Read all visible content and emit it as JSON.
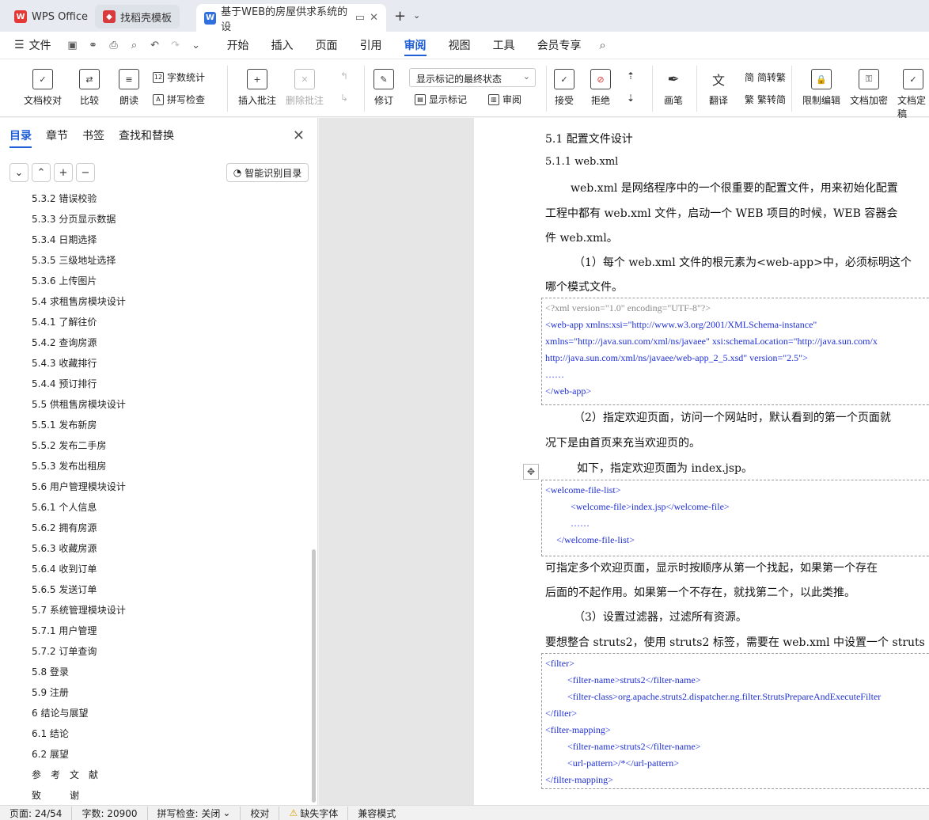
{
  "tabs": [
    {
      "label": "WPS Office"
    },
    {
      "label": "找稻壳模板"
    },
    {
      "label": "基于WEB的房屋供求系统的设"
    }
  ],
  "menu": {
    "file": "文件",
    "items": [
      "开始",
      "插入",
      "页面",
      "引用",
      "审阅",
      "视图",
      "工具",
      "会员专享"
    ]
  },
  "ribbon": {
    "doc_check": "文档校对",
    "compare": "比较",
    "read": "朗读",
    "word_count": "字数统计",
    "spell_check": "拼写检查",
    "insert_comment": "插入批注",
    "delete_comment": "删除批注",
    "revise": "修订",
    "markup_select": "显示标记的最终状态",
    "show_markup": "显示标记",
    "review": "审阅",
    "accept": "接受",
    "reject": "拒绝",
    "pen": "画笔",
    "translate": "翻译",
    "to_trad": "简转繁",
    "to_simp": "繁转简",
    "restrict": "限制编辑",
    "encrypt": "文档加密",
    "doc_final": "文档定稿"
  },
  "sidebar": {
    "tabs": [
      "目录",
      "章节",
      "书签",
      "查找和替换"
    ],
    "smart_toc": "智能识别目录",
    "toc": [
      "5.3.2 错误校验",
      "5.3.3 分页显示数据",
      "5.3.4 日期选择",
      "5.3.5 三级地址选择",
      "5.3.6 上传图片",
      "5.4 求租售房模块设计",
      "5.4.1 了解往价",
      "5.4.2 查询房源",
      "5.4.3 收藏排行",
      "5.4.4 预订排行",
      "5.5 供租售房模块设计",
      "5.5.1 发布新房",
      "5.5.2 发布二手房",
      "5.5.3 发布出租房",
      "5.6 用户管理模块设计",
      "5.6.1 个人信息",
      "5.6.2 拥有房源",
      "5.6.3 收藏房源",
      "5.6.4 收到订单",
      "5.6.5 发送订单",
      "5.7 系统管理模块设计",
      "5.7.1 用户管理",
      "5.7.2 订单查询",
      "5.8 登录",
      "5.9 注册",
      "6 结论与展望",
      "6.1 结论",
      "6.2 展望",
      "参　考　文　献",
      "致　　　谢"
    ]
  },
  "doc": {
    "h1": "5.1  配置文件设计",
    "h2": "5.1.1 web.xml",
    "p1a": "web.xml 是网络程序中的一个很重要的配置文件，用来初始化配置",
    "p1b": "工程中都有 web.xml 文件，启动一个 WEB 项目的时候，WEB 容器会",
    "p1c": "件 web.xml。",
    "p2a": "（1）每个 web.xml 文件的根元素为<web-app>中，必须标明这个",
    "p2b": "哪个模式文件。",
    "c1": [
      "<?xml version=\"1.0\" encoding=\"UTF-8\"?>",
      "<web-app xmlns:xsi=\"http://www.w3.org/2001/XMLSchema-instance\"",
      "xmlns=\"http://java.sun.com/xml/ns/javaee\" xsi:schemaLocation=\"http://java.sun.com/x",
      "http://java.sun.com/xml/ns/javaee/web-app_2_5.xsd\" version=\"2.5\">",
      "……",
      "</web-app>"
    ],
    "p3a": "（2）指定欢迎页面，访问一个网站时，默认看到的第一个页面就",
    "p3b": "况下是由首页来充当欢迎页的。",
    "p3c": "如下，指定欢迎页面为 index.jsp。",
    "c2": [
      "<welcome-file-list>",
      "<welcome-file>index.jsp</welcome-file>",
      "……",
      "</welcome-file-list>"
    ],
    "p4a": "可指定多个欢迎页面，显示时按顺序从第一个找起，如果第一个存在",
    "p4b": "后面的不起作用。如果第一个不存在，就找第二个，以此类推。",
    "p5": "（3）设置过滤器，过滤所有资源。",
    "p6": "要想整合 struts2，使用 struts2 标签，需要在 web.xml 中设置一个 struts",
    "c3": [
      "<filter>",
      "<filter-name>struts2</filter-name>",
      "<filter-class>org.apache.struts2.dispatcher.ng.filter.StrutsPrepareAndExecuteFilter",
      "</filter>",
      "<filter-mapping>",
      "<filter-name>struts2</filter-name>",
      "<url-pattern>/*</url-pattern>",
      "</filter-mapping>"
    ]
  },
  "status": {
    "page": "页面: 24/54",
    "words": "字数: 20900",
    "spell": "拼写检查: 关闭",
    "proof": "校对",
    "missing_font": "缺失字体",
    "compat": "兼容模式"
  }
}
